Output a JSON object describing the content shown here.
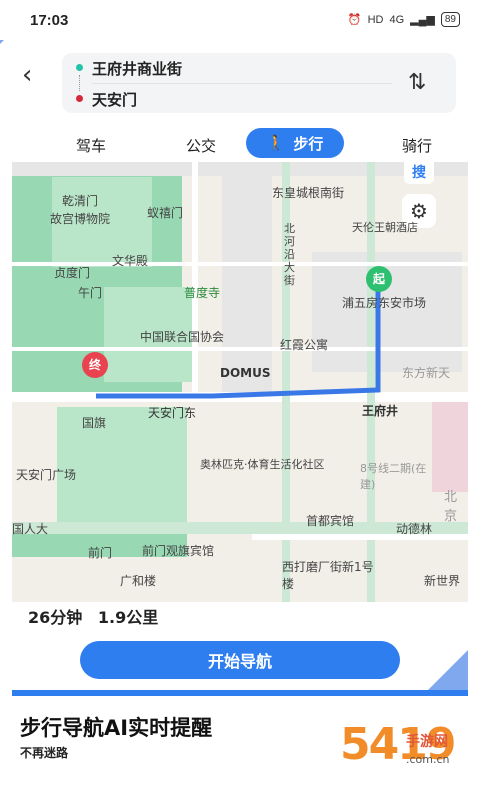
{
  "status_bar": {
    "time": "17:03",
    "net": "HD",
    "signal": "4G",
    "battery": "89"
  },
  "route": {
    "origin": "王府井商业街",
    "destination": "天安门"
  },
  "tabs": [
    {
      "label": "驾车"
    },
    {
      "label": "公交"
    },
    {
      "label": "步行",
      "active": true
    },
    {
      "label": "骑行"
    }
  ],
  "map": {
    "search_badge": "搜",
    "labels": [
      "东皇城根南街",
      "乾清门",
      "故宫博物院",
      "蚁禧门",
      "文华殿",
      "贞度门",
      "午门",
      "普度寺",
      "中国联合国协会",
      "DOMUS",
      "红霞公寓",
      "东方新天",
      "天伦王朝酒店",
      "浦五房东安市场",
      "北河沿大街",
      "王府井",
      "天安门东",
      "国旗",
      "天安门广场",
      "奥林匹克·体育生活化社区",
      "8号线二期(在建)",
      "北京",
      "首都宾馆",
      "动德林",
      "国人大",
      "前门",
      "前门观旗宾馆",
      "西打磨厂街新1号楼",
      "广和楼",
      "新世界"
    ],
    "start_marker": "起",
    "end_marker": "终"
  },
  "summary": {
    "duration": "26分钟",
    "distance": "1.9公里"
  },
  "start_button": "开始导航",
  "headline": "步行导航AI实时提醒",
  "subline": "不再迷路",
  "watermark": {
    "main": "5419",
    "brand": "手游网",
    "url": ".com.cn"
  },
  "colors": {
    "accent": "#2f7ef0",
    "origin_dot": "#23c3a8",
    "dest_dot": "#d6283a",
    "route_line": "#3b78e7"
  }
}
